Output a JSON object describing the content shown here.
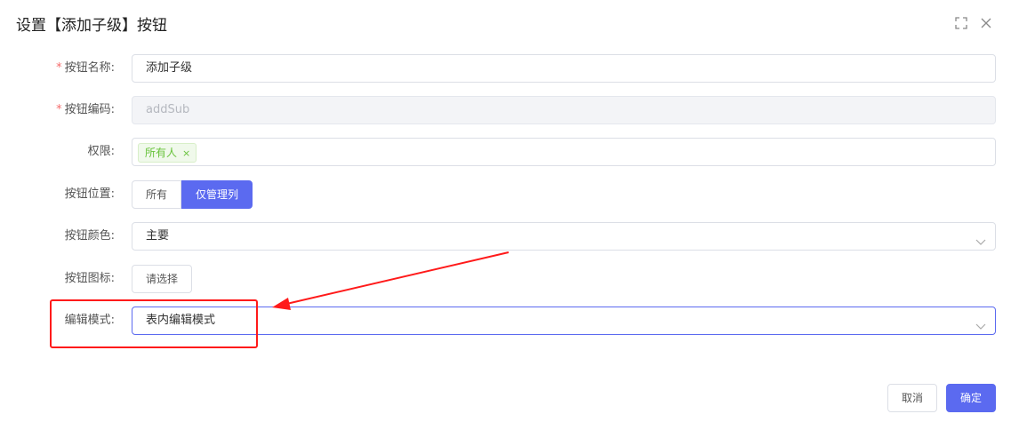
{
  "dialog": {
    "title": "设置【添加子级】按钮",
    "expand_icon": "fullscreen-icon",
    "close_icon": "close-icon"
  },
  "form": {
    "name": {
      "label": "按钮名称:",
      "required": "*",
      "value": "添加子级"
    },
    "code": {
      "label": "按钮编码:",
      "required": "*",
      "value": "addSub"
    },
    "permission": {
      "label": "权限:",
      "tag": "所有人",
      "tag_close": "×"
    },
    "position": {
      "label": "按钮位置:",
      "options": [
        "所有",
        "仅管理列"
      ],
      "selected": "仅管理列"
    },
    "color": {
      "label": "按钮颜色:",
      "value": "主要"
    },
    "icon": {
      "label": "按钮图标:",
      "button": "请选择"
    },
    "edit_mode": {
      "label": "编辑模式:",
      "value": "表内编辑模式"
    }
  },
  "footer": {
    "cancel": "取消",
    "confirm": "确定"
  },
  "colors": {
    "primary": "#5b6af0",
    "annotation": "#ff1a1a",
    "tag_green": "#67c23a"
  }
}
